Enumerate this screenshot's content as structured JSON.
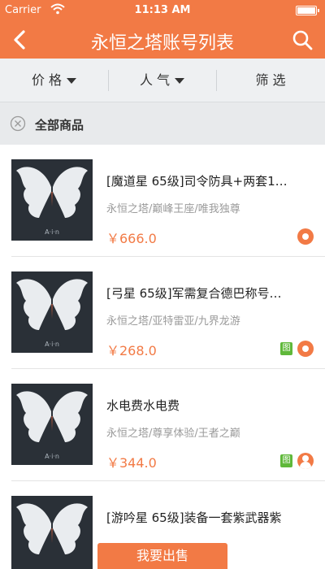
{
  "status_bar": {
    "carrier": "Carrier",
    "time": "11:13 AM"
  },
  "nav": {
    "title": "永恒之塔账号列表",
    "back_icon": "chevron-left-icon",
    "search_icon": "search-icon"
  },
  "filters": [
    {
      "label": "价 格"
    },
    {
      "label": "人 气"
    },
    {
      "label": "筛 选"
    }
  ],
  "all_goods": {
    "label": "全部商品",
    "icon": "close-circle-icon"
  },
  "items": [
    {
      "title": "[魔道星 65级]司令防具+两套1…",
      "subtitle": "永恒之塔/巅峰王座/唯我独尊",
      "price": "￥666.0",
      "badges": [
        "orange-dot-badge"
      ]
    },
    {
      "title": "[弓星 65级]军需复合德巴称号…",
      "subtitle": "永恒之塔/亚特雷亚/九界龙游",
      "price": "￥268.0",
      "badges": [
        "green-tag-badge",
        "orange-dot-badge"
      ]
    },
    {
      "title": "水电费水电费",
      "subtitle": "永恒之塔/尊享体验/王者之巅",
      "price": "￥344.0",
      "badges": [
        "green-tag-badge",
        "orange-user-badge"
      ]
    },
    {
      "title": "[游吟星 65级]装备一套紫武器紫",
      "subtitle": "",
      "price": "",
      "badges": []
    }
  ],
  "badge_text": "图",
  "sell_button": {
    "label": "我要出售"
  },
  "colors": {
    "accent": "#f27a45",
    "badge_green": "#5fb83a",
    "filter_bg": "#eef0f2"
  }
}
